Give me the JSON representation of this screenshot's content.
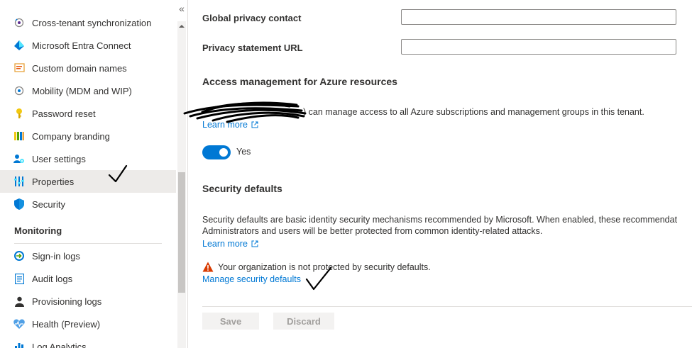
{
  "sidebar": {
    "collapse_glyph": "«",
    "items": [
      {
        "label": "Cross-tenant synchronization",
        "icon": "cross-tenant-sync-icon"
      },
      {
        "label": "Microsoft Entra Connect",
        "icon": "entra-connect-icon"
      },
      {
        "label": "Custom domain names",
        "icon": "custom-domain-icon"
      },
      {
        "label": "Mobility (MDM and WIP)",
        "icon": "mobility-icon"
      },
      {
        "label": "Password reset",
        "icon": "key-icon"
      },
      {
        "label": "Company branding",
        "icon": "branding-icon"
      },
      {
        "label": "User settings",
        "icon": "user-settings-icon"
      },
      {
        "label": "Properties",
        "icon": "properties-icon",
        "selected": true
      },
      {
        "label": "Security",
        "icon": "shield-icon"
      }
    ],
    "monitoring": {
      "header": "Monitoring",
      "items": [
        {
          "label": "Sign-in logs",
          "icon": "sign-in-logs-icon"
        },
        {
          "label": "Audit logs",
          "icon": "audit-logs-icon"
        },
        {
          "label": "Provisioning logs",
          "icon": "provisioning-logs-icon"
        },
        {
          "label": "Health (Preview)",
          "icon": "health-icon"
        },
        {
          "label": "Log Analytics",
          "icon": "log-analytics-icon"
        }
      ]
    }
  },
  "main": {
    "global_privacy_contact": {
      "label": "Global privacy contact",
      "value": ""
    },
    "privacy_statement_url": {
      "label": "Privacy statement URL",
      "value": ""
    },
    "access_management": {
      "heading": "Access management for Azure resources",
      "description": ") can manage access to all Azure subscriptions and management groups in this tenant.",
      "learn_more": "Learn more",
      "toggle_on": true,
      "toggle_label": "Yes"
    },
    "security_defaults": {
      "heading": "Security defaults",
      "description_line1": "Security defaults are basic identity security mechanisms recommended by Microsoft. When enabled, these recommendat",
      "description_line2": "Administrators and users will be better protected from common identity-related attacks.",
      "learn_more": "Learn more",
      "warning": "Your organization is not protected by security defaults.",
      "manage_link": "Manage security defaults"
    },
    "footer": {
      "save_label": "Save",
      "discard_label": "Discard"
    }
  },
  "colors": {
    "accent": "#0078d4",
    "warning": "#d83b01",
    "selected_bg": "#edebe9"
  }
}
